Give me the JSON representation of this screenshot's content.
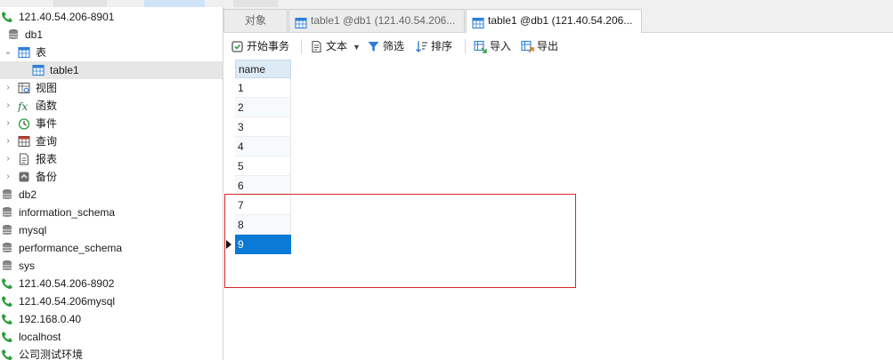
{
  "sidebar": {
    "items": [
      {
        "label": "121.40.54.206-8901",
        "icon": "connection-icon",
        "level": 0,
        "expanded": true,
        "selected": false
      },
      {
        "label": "db1",
        "icon": "database-icon",
        "level": 1,
        "expanded": true,
        "selected": false
      },
      {
        "label": "表",
        "icon": "table-group-icon",
        "level": 1,
        "expanded": true,
        "selected": false
      },
      {
        "label": "table1",
        "icon": "table-icon",
        "level": 2,
        "expanded": false,
        "selected": true
      },
      {
        "label": "视图",
        "icon": "view-icon",
        "level": 1,
        "expanded": false,
        "selected": false
      },
      {
        "label": "函数",
        "icon": "function-icon",
        "level": 1,
        "expanded": false,
        "selected": false
      },
      {
        "label": "事件",
        "icon": "event-clock-icon",
        "level": 1,
        "expanded": false,
        "selected": false
      },
      {
        "label": "查询",
        "icon": "query-icon",
        "level": 1,
        "expanded": false,
        "selected": false
      },
      {
        "label": "报表",
        "icon": "report-icon",
        "level": 1,
        "expanded": false,
        "selected": false
      },
      {
        "label": "备份",
        "icon": "backup-icon",
        "level": 1,
        "expanded": false,
        "selected": false
      },
      {
        "label": "db2",
        "icon": "database-icon",
        "level": 0,
        "expanded": false,
        "selected": false
      },
      {
        "label": "information_schema",
        "icon": "database-icon",
        "level": 0,
        "expanded": false,
        "selected": false
      },
      {
        "label": "mysql",
        "icon": "database-icon",
        "level": 0,
        "expanded": false,
        "selected": false
      },
      {
        "label": "performance_schema",
        "icon": "database-icon",
        "level": 0,
        "expanded": false,
        "selected": false
      },
      {
        "label": "sys",
        "icon": "database-icon",
        "level": 0,
        "expanded": false,
        "selected": false
      },
      {
        "label": "121.40.54.206-8902",
        "icon": "connection-icon",
        "level": 0,
        "expanded": false,
        "selected": false
      },
      {
        "label": "121.40.54.206mysql",
        "icon": "connection-icon",
        "level": 0,
        "expanded": false,
        "selected": false
      },
      {
        "label": "192.168.0.40",
        "icon": "connection-icon",
        "level": 0,
        "expanded": false,
        "selected": false
      },
      {
        "label": "localhost",
        "icon": "connection-icon",
        "level": 0,
        "expanded": false,
        "selected": false
      },
      {
        "label": "公司测试环境",
        "icon": "connection-icon",
        "level": 0,
        "expanded": false,
        "selected": false
      }
    ]
  },
  "tabs": [
    {
      "label": "对象",
      "icon": "",
      "active": false
    },
    {
      "label": "table1 @db1 (121.40.54.206...",
      "icon": "table-icon",
      "active": false
    },
    {
      "label": "table1 @db1 (121.40.54.206...",
      "icon": "table-icon",
      "active": true
    }
  ],
  "toolbar": {
    "begin_transaction": "开始事务",
    "text": "文本",
    "filter": "筛选",
    "sort": "排序",
    "import": "导入",
    "export": "导出"
  },
  "grid": {
    "column": "name",
    "rows": [
      "1",
      "2",
      "3",
      "4",
      "5",
      "6",
      "7",
      "8",
      "9"
    ],
    "selected_row": 8
  },
  "colors": {
    "selection": "#0a7ad6",
    "highlight_box": "#d42a2a",
    "header_bg": "#ddebf7"
  }
}
